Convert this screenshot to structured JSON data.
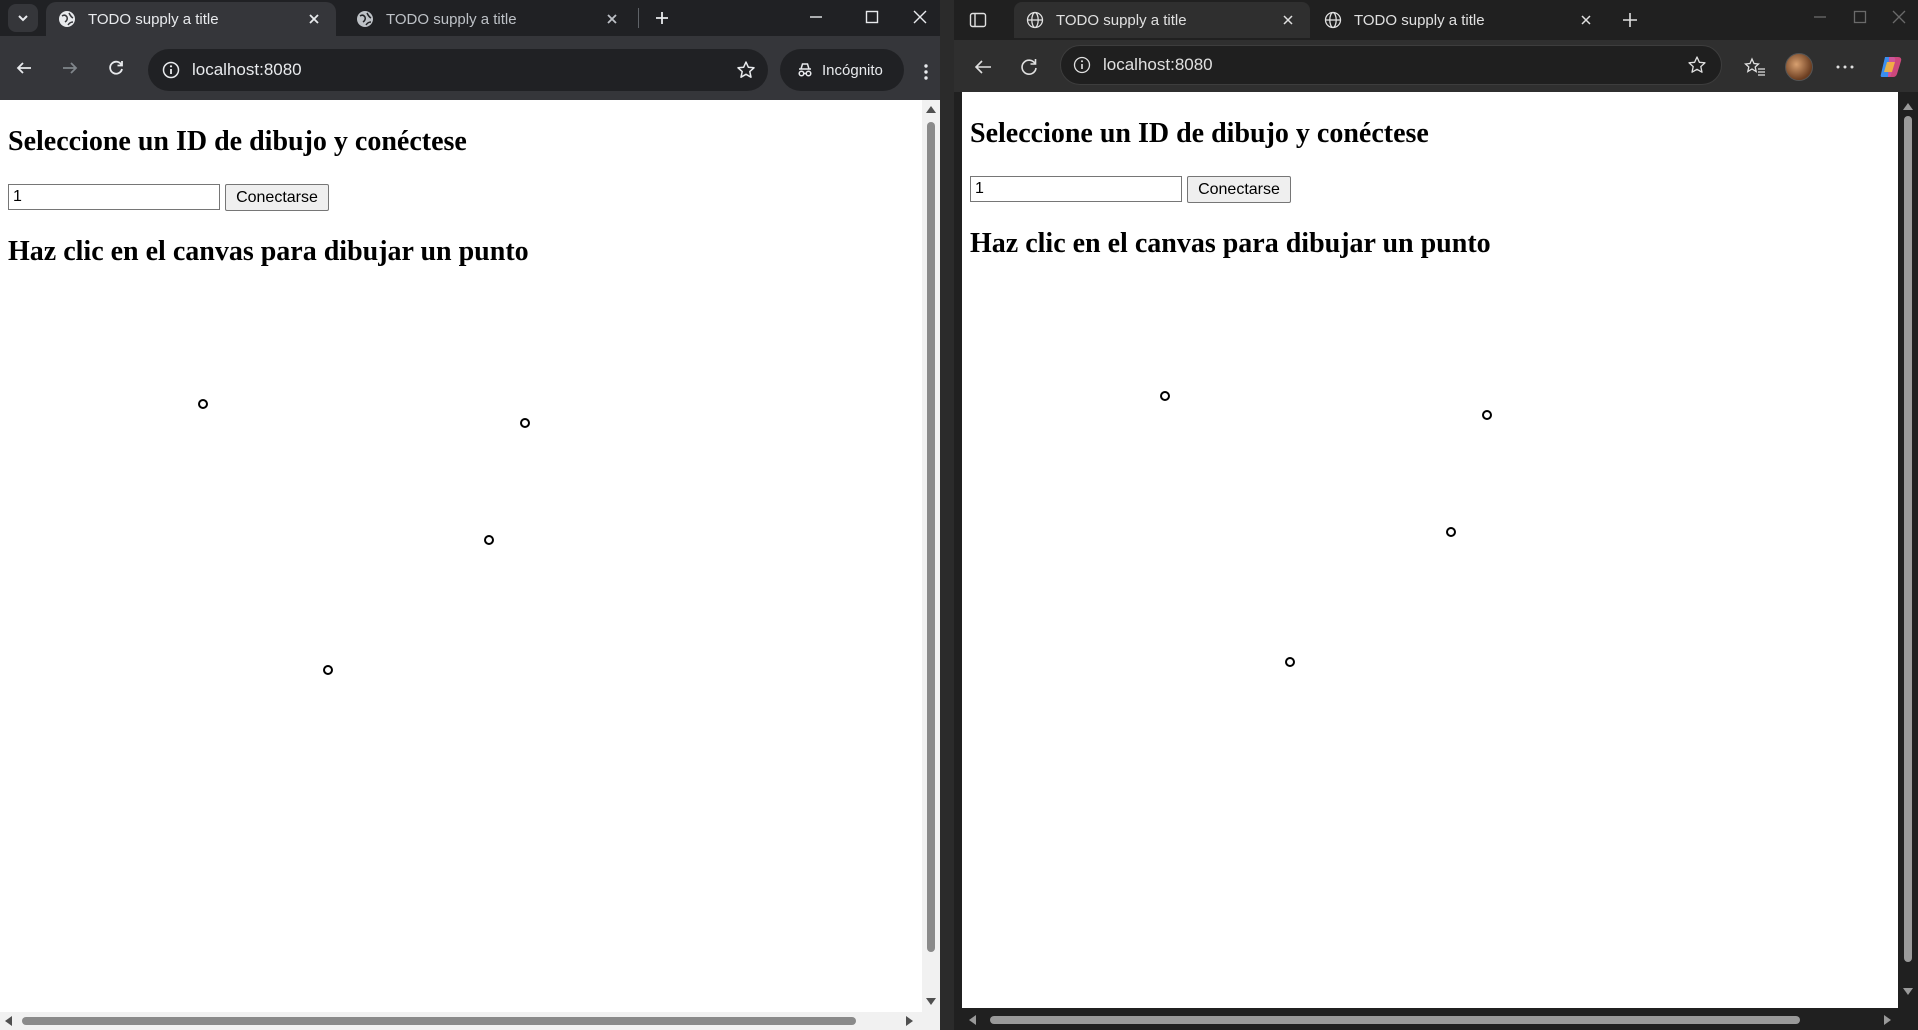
{
  "left_window": {
    "tabs": [
      {
        "title": "TODO supply a title",
        "active": true
      },
      {
        "title": "TODO supply a title",
        "active": false
      }
    ],
    "url": "localhost:8080",
    "incognito_label": "Incógnito",
    "page": {
      "heading": "Seleccione un ID de dibujo y conéctese",
      "input_value": "1",
      "button_label": "Conectarse",
      "canvas_heading": "Haz clic en el canvas para dibujar un punto"
    }
  },
  "right_window": {
    "tabs": [
      {
        "title": "TODO supply a title",
        "active": true
      },
      {
        "title": "TODO supply a title",
        "active": false
      }
    ],
    "url": "localhost:8080",
    "page": {
      "heading": "Seleccione un ID de dibujo y conéctese",
      "input_value": "1",
      "button_label": "Conectarse",
      "canvas_heading": "Haz clic en el canvas para dibujar un punto"
    }
  },
  "canvas_point_count": 4,
  "colors": {
    "chrome_frame": "#202124",
    "chrome_toolbar": "#35363a",
    "edge_frame": "#202020",
    "edge_toolbar": "#2f2f2f"
  }
}
